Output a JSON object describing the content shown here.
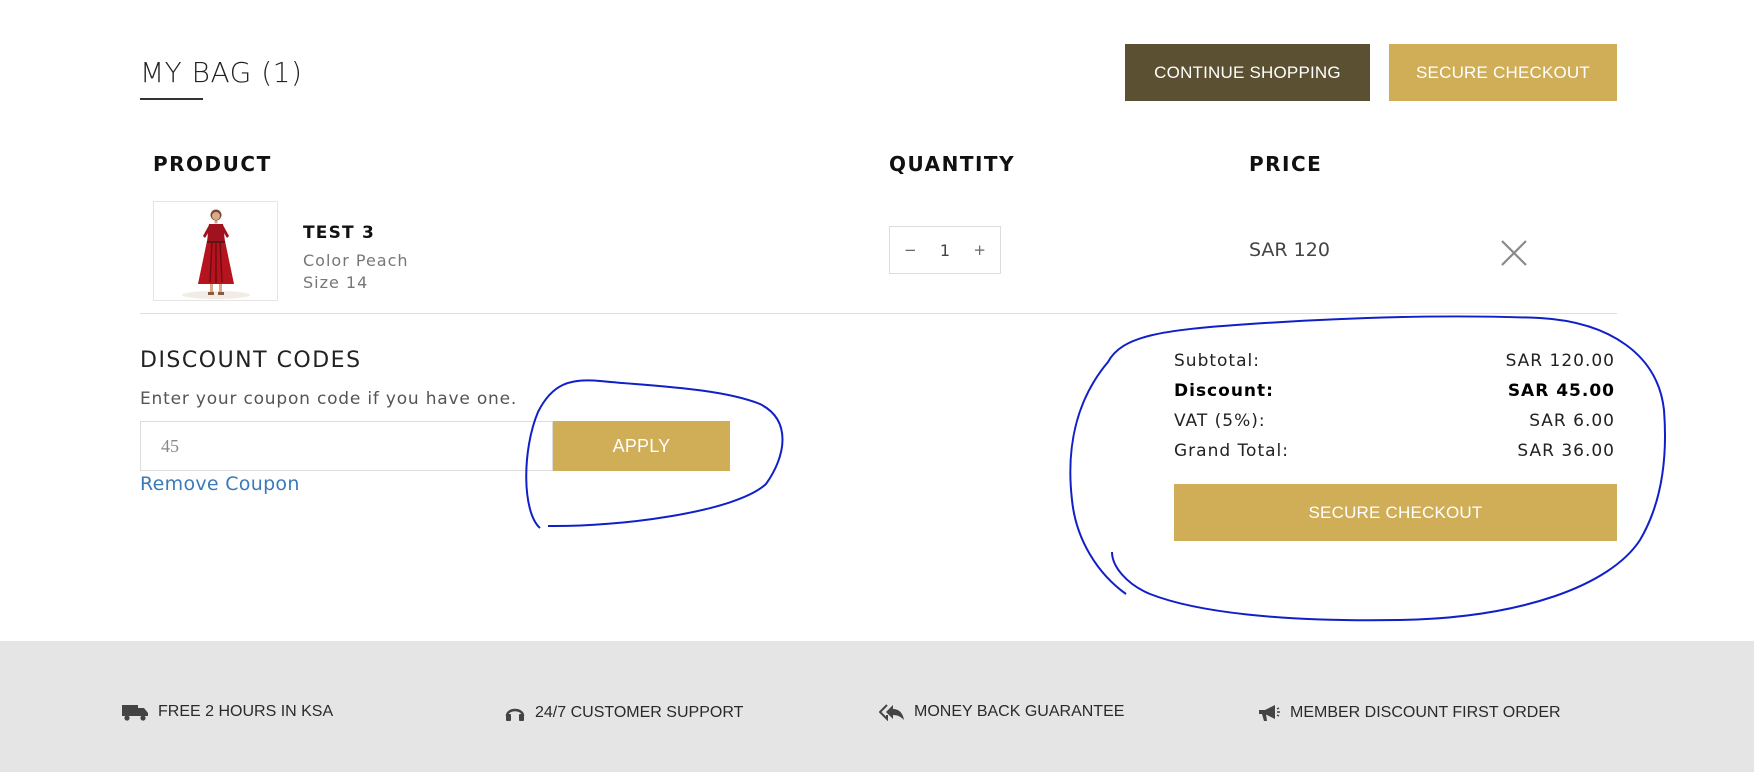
{
  "header": {
    "title": "MY BAG (1)",
    "continue_label": "CONTINUE SHOPPING",
    "secure_checkout_label": "SECURE CHECKOUT"
  },
  "table": {
    "columns": [
      "PRODUCT",
      "QUANTITY",
      "PRICE"
    ]
  },
  "items": [
    {
      "name": "TEST 3",
      "color": "Color Peach",
      "size": "Size 14",
      "quantity": "1",
      "price": "SAR 120",
      "image_icon": "dress-product-image"
    }
  ],
  "quantity_controls": {
    "decrement": "−",
    "increment": "+"
  },
  "discount": {
    "title": "DISCOUNT CODES",
    "hint": "Enter your coupon code if you have one.",
    "input_value": "45",
    "apply_label": "APPLY",
    "remove_label": "Remove Coupon"
  },
  "summary": {
    "rows": [
      {
        "label": "Subtotal:",
        "value": "SAR 120.00"
      },
      {
        "label": "Discount:",
        "value": "SAR 45.00"
      },
      {
        "label": "VAT (5%):",
        "value": "SAR 6.00"
      },
      {
        "label": "Grand Total:",
        "value": "SAR 36.00"
      }
    ],
    "checkout_label": "SECURE CHECKOUT"
  },
  "footer": {
    "features": [
      {
        "label": "FREE 2 HOURS IN KSA",
        "icon": "truck-icon"
      },
      {
        "label": "24/7 CUSTOMER SUPPORT",
        "icon": "headset-icon"
      },
      {
        "label": "MONEY BACK GUARANTEE",
        "icon": "reply-all-icon"
      },
      {
        "label": "MEMBER DISCOUNT FIRST ORDER",
        "icon": "megaphone-icon"
      }
    ]
  },
  "colors": {
    "gold": "#cfae57",
    "dark_brown": "#5c5032",
    "link_blue": "#3a7ab8",
    "annotation_blue": "#1020c8",
    "footer_bg": "#e5e5e5"
  }
}
